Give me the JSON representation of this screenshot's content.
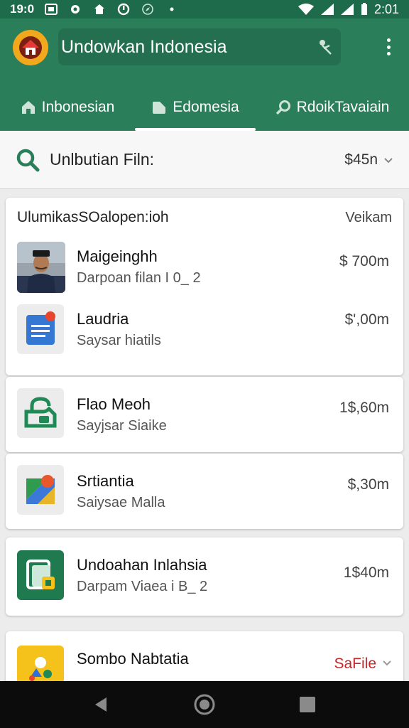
{
  "status_bar": {
    "time_left": "19:0",
    "time_right": "2:01"
  },
  "app_bar": {
    "title": "Undowkan Indonesia",
    "tabs": [
      {
        "label": "Inbonesian",
        "icon": "home-icon",
        "selected": false
      },
      {
        "label": "Edomesia",
        "icon": "document-icon",
        "selected": true
      },
      {
        "label": "RdoikTavaiain",
        "icon": "search-icon",
        "selected": false
      }
    ]
  },
  "search_row": {
    "label": "Unlbutian Filn:",
    "sort_value": "$45n"
  },
  "cards": [
    {
      "header": {
        "title": "UlumikasSOalopen:ioh",
        "right": "Veikam"
      },
      "rows": [
        {
          "name": "Maigeinghh",
          "sub": "Darpoan filan I 0_ 2",
          "price": "$ 700m",
          "thumb": "person-photo"
        },
        {
          "name": "Laudria",
          "sub": "Saysar hiatils",
          "price": "$',00m",
          "thumb": "docs-icon"
        }
      ]
    },
    {
      "rows": [
        {
          "name": "Flao Meoh",
          "sub": "Sayjsar Siaike",
          "price": "1$,60m",
          "thumb": "lock-icon"
        }
      ]
    },
    {
      "rows": [
        {
          "name": "Srtiantia",
          "sub": "Saiysae Malla",
          "price": "$,30m",
          "thumb": "maps-icon"
        }
      ]
    },
    {
      "rows": [
        {
          "name": "Undoahan Inlahsia",
          "sub": "Darpam Viaea i B_ 2",
          "price": "1$40m",
          "thumb": "files-icon"
        }
      ]
    },
    {
      "rows": [
        {
          "name": "Sombo Nabtatia",
          "sub": "",
          "price": "SaFile",
          "thumb": "photos-icon"
        }
      ]
    }
  ],
  "colors": {
    "primary": "#2a7f5a",
    "status_bar": "#1d6b4a",
    "accent_red": "#c62828",
    "background": "#ececec"
  }
}
